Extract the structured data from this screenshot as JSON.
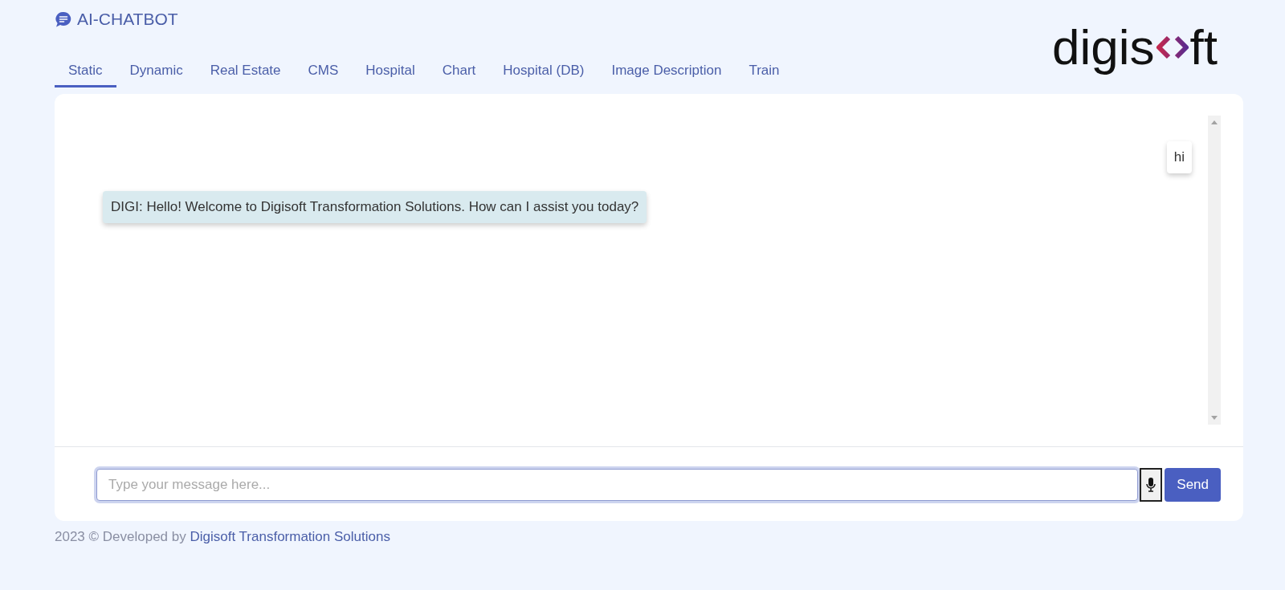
{
  "app": {
    "title": "AI-CHATBOT",
    "logo": {
      "before": "digis",
      "after": "ft"
    }
  },
  "tabs": [
    {
      "label": "Static",
      "selected": true
    },
    {
      "label": "Dynamic",
      "selected": false
    },
    {
      "label": "Real Estate",
      "selected": false
    },
    {
      "label": "CMS",
      "selected": false
    },
    {
      "label": "Hospital",
      "selected": false
    },
    {
      "label": "Chart",
      "selected": false
    },
    {
      "label": "Hospital (DB)",
      "selected": false
    },
    {
      "label": "Image Description",
      "selected": false
    },
    {
      "label": "Train",
      "selected": false
    }
  ],
  "messages": [
    {
      "kind": "user",
      "text": "hi"
    },
    {
      "kind": "bot",
      "text": "DIGI: Hello! Welcome to Digisoft Transformation Solutions. How can I assist you today?"
    }
  ],
  "composer": {
    "placeholder": "Type your message here...",
    "send": "Send"
  },
  "footer": {
    "text": "2023 © Developed by ",
    "link": "Digisoft Transformation Solutions"
  }
}
